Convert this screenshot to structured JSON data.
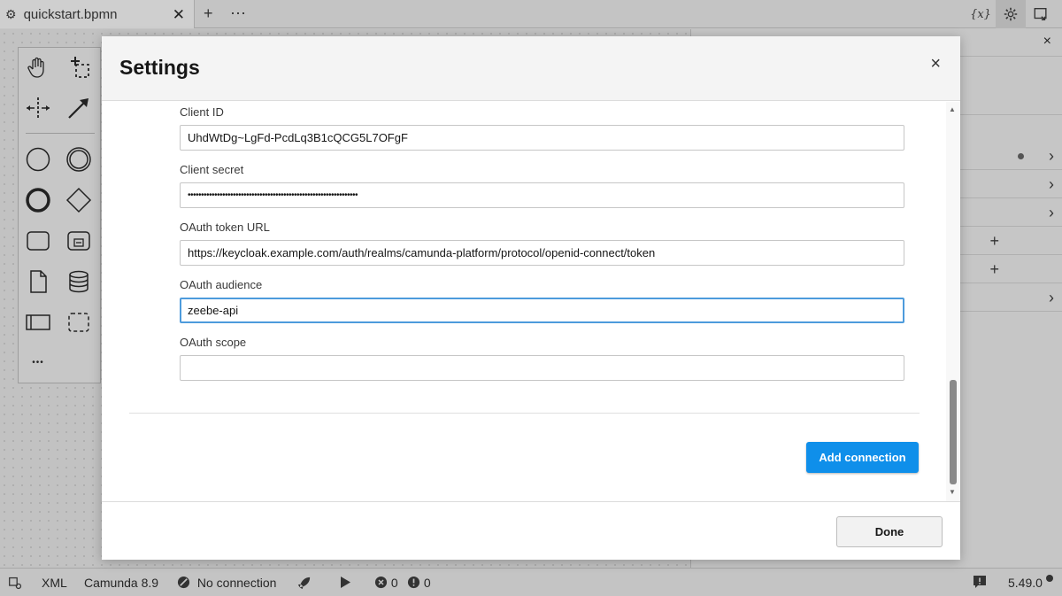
{
  "tabbar": {
    "file_tab": "quickstart.bpmn",
    "add_tab": "+",
    "more_tabs": "⋯",
    "variables_btn": "{x}"
  },
  "properties_panel": {
    "close": "×",
    "rows": [
      {
        "ctl": "›",
        "dot": true
      },
      {
        "ctl": "›"
      },
      {
        "ctl": "›"
      },
      {
        "ctl": "+"
      },
      {
        "ctl": "+"
      },
      {
        "ctl": "›"
      }
    ]
  },
  "palette": {
    "more": "•••"
  },
  "modal": {
    "title": "Settings",
    "close": "×",
    "fields": [
      {
        "label": "Client ID",
        "value": "UhdWtDg~LgFd-PcdLq3B1cQCG5L7OFgF"
      },
      {
        "label": "Client secret",
        "value": "••••••••••••••••••••••••••••••••••••••••••••••••••••••••••••••••"
      },
      {
        "label": "OAuth token URL",
        "value": "https://keycloak.example.com/auth/realms/camunda-platform/protocol/openid-connect/token"
      },
      {
        "label": "OAuth audience",
        "value": "zeebe-api"
      },
      {
        "label": "OAuth scope",
        "value": ""
      }
    ],
    "add_connection": "Add connection",
    "done": "Done"
  },
  "statusbar": {
    "xml": "XML",
    "platform": "Camunda 8.9",
    "connection": "No connection",
    "errors": "0",
    "warnings": "0",
    "version": "5.49.0"
  }
}
